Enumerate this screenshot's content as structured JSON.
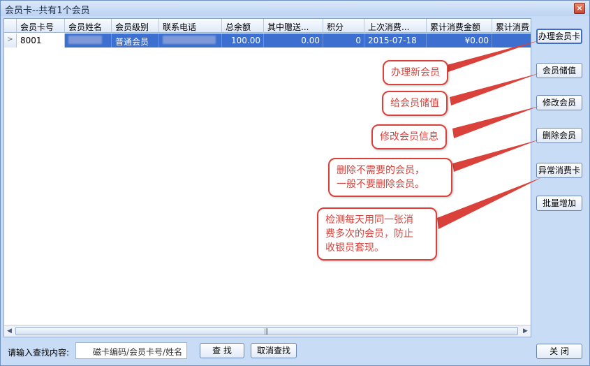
{
  "window": {
    "title": "会员卡--共有1个会员",
    "close_label": "×"
  },
  "table": {
    "columns": [
      "会员卡号",
      "会员姓名",
      "会员级别",
      "联系电话",
      "总余额",
      "其中赠送...",
      "积分",
      "上次消费...",
      "累计消费金额",
      "累计消费"
    ],
    "rows": [
      {
        "indicator": ">",
        "card_no": "8001",
        "name": "",
        "level": "普通会员",
        "phone": "",
        "balance": "100.00",
        "gift": "0.00",
        "points": "0",
        "last_date": "2015-07-18",
        "total": "¥0.00",
        "total2": ""
      }
    ]
  },
  "side_buttons": [
    "办理会员卡",
    "会员储值",
    "修改会员",
    "删除会员",
    "异常消费卡",
    "批量增加"
  ],
  "callouts": {
    "new_member": "办理新会员",
    "recharge": "给会员储值",
    "modify": "修改会员信息",
    "delete_line1": "删除不需要的会员，",
    "delete_line2": "一般不要删除会员。",
    "abnormal_line1": "检测每天用同一张消",
    "abnormal_line2": "费多次的会员，防止",
    "abnormal_line3": "收银员套现。"
  },
  "search": {
    "label": "请输入查找内容:",
    "placeholder": "磁卡编码/会员卡号/姓名",
    "find_label": "查  找",
    "cancel_label": "取消查找"
  },
  "close_button": "关  闭",
  "colors": {
    "selection": "#3c6fd0",
    "callout_red": "#d9413a",
    "window_bg": "#c9dcf5"
  }
}
